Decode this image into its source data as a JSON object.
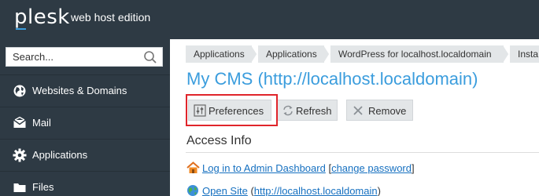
{
  "header": {
    "logo_text": "plesk",
    "edition": "web host edition"
  },
  "sidebar": {
    "search_placeholder": "Search...",
    "items": [
      {
        "label": "Websites & Domains",
        "icon": "globe-icon"
      },
      {
        "label": "Mail",
        "icon": "envelope-icon"
      },
      {
        "label": "Applications",
        "icon": "gear-icon"
      },
      {
        "label": "Files",
        "icon": "folder-icon"
      }
    ]
  },
  "breadcrumbs": [
    "Applications",
    "Applications",
    "WordPress for localhost.localdomain",
    "Insta"
  ],
  "page": {
    "title": "My CMS (http://localhost.localdomain)"
  },
  "toolbar": {
    "preferences_label": "Preferences",
    "refresh_label": "Refresh",
    "remove_label": "Remove"
  },
  "access_info": {
    "heading": "Access Info",
    "login_link": "Log in to Admin Dashboard",
    "bracket_open": "[",
    "change_password": "change password",
    "bracket_close": "]",
    "open_site_link": "Open Site",
    "site_url_open": "(",
    "site_url": "http://localhost.localdomain",
    "site_url_close": ")"
  },
  "colors": {
    "header_bg": "#2e3a44",
    "accent": "#3b9ddd",
    "link": "#1670c0",
    "highlight": "#e0252b"
  }
}
